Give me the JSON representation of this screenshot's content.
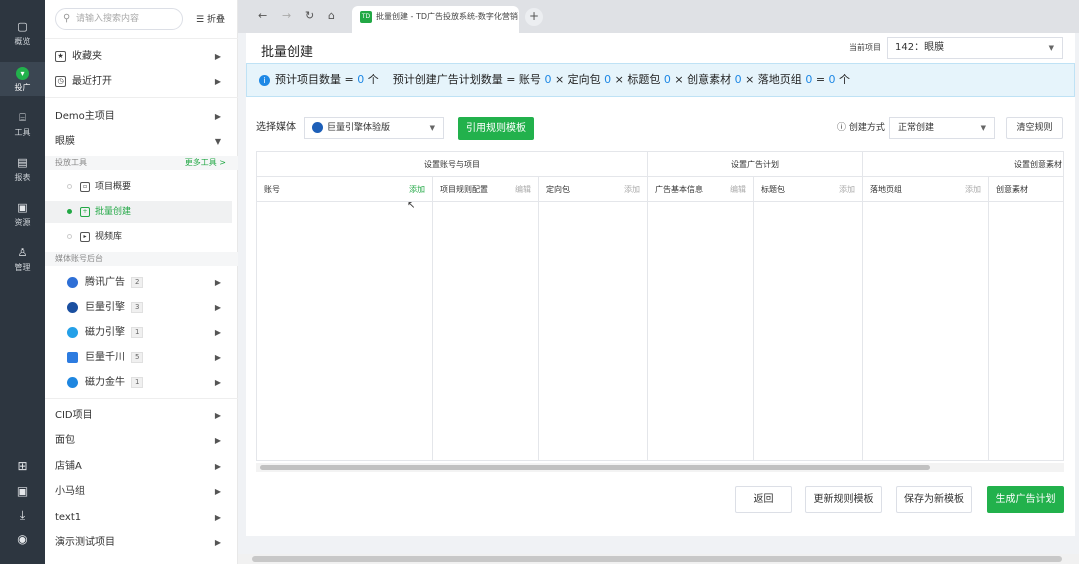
{
  "rail": {
    "items": [
      {
        "label": "概览",
        "icon": "dashboard-icon"
      },
      {
        "label": "投广",
        "icon": "ad-icon"
      },
      {
        "label": "工具",
        "icon": "tool-icon"
      },
      {
        "label": "报表",
        "icon": "report-icon"
      },
      {
        "label": "资源",
        "icon": "resource-icon"
      },
      {
        "label": "管理",
        "icon": "user-icon"
      }
    ],
    "bottom_icons": [
      "grid-icon",
      "window-icon",
      "download-icon",
      "account-icon"
    ]
  },
  "sidebar": {
    "search_placeholder": "请输入搜索内容",
    "fold_label": "折叠",
    "favorites": "收藏夹",
    "recent": "最近打开",
    "demo_project": "Demo主项目",
    "current_project": "眼膜",
    "tools_group": "投放工具",
    "more_tools": "更多工具 >",
    "tools": [
      "项目概要",
      "批量创建",
      "视频库"
    ],
    "media_group": "媒体账号后台",
    "media": [
      {
        "name": "腾讯广告",
        "count": "2"
      },
      {
        "name": "巨量引擎",
        "count": "3"
      },
      {
        "name": "磁力引擎",
        "count": "1"
      },
      {
        "name": "巨量千川",
        "count": "5"
      },
      {
        "name": "磁力金牛",
        "count": "1"
      }
    ],
    "projects": [
      "CID项目",
      "面包",
      "店铺A",
      "小马组",
      "text1",
      "演示测试项目"
    ]
  },
  "browser": {
    "tab_title": "批量创建 - TD广告投放系统-数字化营销",
    "tab_icon": "TD",
    "nav": [
      "←",
      "→",
      "↻",
      "⌂"
    ],
    "new_tab": "+"
  },
  "page": {
    "title": "批量创建",
    "project_label": "当前项目",
    "project_value": "142：眼膜",
    "banner": {
      "prefix": "预计项目数量 =",
      "project_count": "0",
      "unit": "个",
      "plan_prefix": "预计创建广告计划数量 = 账号",
      "account": "0",
      "x1": "× 定向包",
      "targeting": "0",
      "x2": "× 标题包",
      "titles": "0",
      "x3": "× 创意素材",
      "creative": "0",
      "x4": "× 落地页组",
      "landing": "0",
      "eq": "=",
      "total": "0",
      "unit2": "个"
    },
    "toolbar": {
      "media_label": "选择媒体",
      "media_value": "巨量引擎体验版",
      "apply_template": "引用规则模板",
      "create_mode_label": "创建方式",
      "create_mode_value": "正常创建",
      "clear_rules": "清空规则"
    },
    "grid": {
      "groups": [
        "设置账号与项目",
        "设置广告计划",
        "设置创意素材"
      ],
      "columns": [
        {
          "name": "账号",
          "action": "添加"
        },
        {
          "name": "项目规则配置",
          "action": "编辑"
        },
        {
          "name": "定向包",
          "action": "添加"
        },
        {
          "name": "广告基本信息",
          "action": "编辑"
        },
        {
          "name": "标题包",
          "action": "添加"
        },
        {
          "name": "落地页组",
          "action": "添加"
        },
        {
          "name": "创意素材",
          "action": ""
        }
      ]
    },
    "footer": {
      "back": "返回",
      "update_template": "更新规则模板",
      "save_template": "保存为新模板",
      "generate": "生成广告计划"
    }
  }
}
